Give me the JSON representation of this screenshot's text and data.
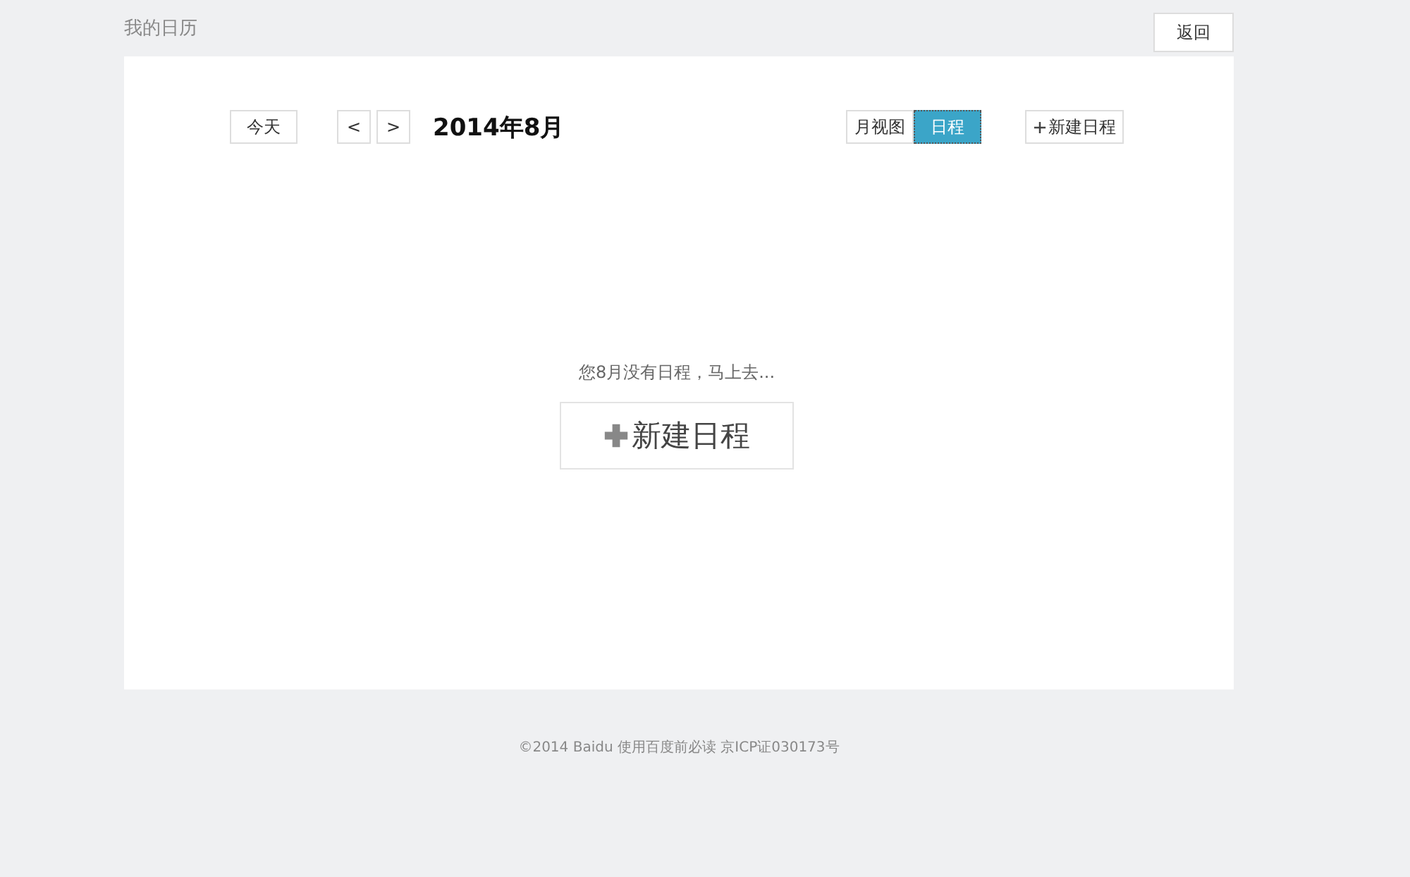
{
  "header": {
    "title": "我的日历",
    "back_button": "返回"
  },
  "toolbar": {
    "today": "今天",
    "prev": "<",
    "next": ">",
    "period": "2014年8月",
    "views": [
      {
        "label": "月视图",
        "selected": false
      },
      {
        "label": "日程",
        "selected": true
      }
    ],
    "new_button": "新建日程"
  },
  "empty_state": {
    "message": "您8月没有日程，马上去...",
    "button": "新建日程"
  },
  "footer": "©2014 Baidu 使用百度前必读 京ICP证030173号"
}
